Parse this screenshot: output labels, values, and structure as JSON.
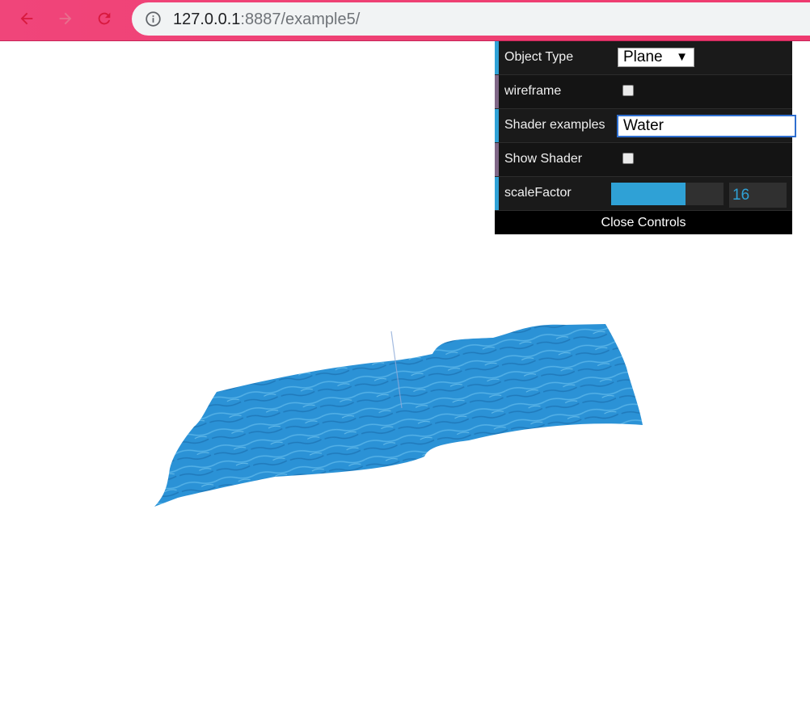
{
  "browser": {
    "url_host": "127.0.0.1",
    "url_rest": ":8887/example5/",
    "icons": [
      "back-arrow-icon",
      "forward-arrow-icon",
      "reload-icon",
      "info-icon"
    ]
  },
  "controls": {
    "object_type": {
      "label": "Object Type",
      "value": "Plane"
    },
    "wireframe": {
      "label": "wireframe",
      "checked": false
    },
    "shader_examples": {
      "label": "Shader examples",
      "value": "Water"
    },
    "show_shader": {
      "label": "Show Shader",
      "checked": false
    },
    "scale_factor": {
      "label": "scaleFactor",
      "value": "16",
      "fill_fraction": 0.66
    },
    "close_label": "Close Controls"
  },
  "colors": {
    "water": "#2b92d6",
    "accent": "#2fa1d6",
    "chrome": "#ee3f72"
  }
}
